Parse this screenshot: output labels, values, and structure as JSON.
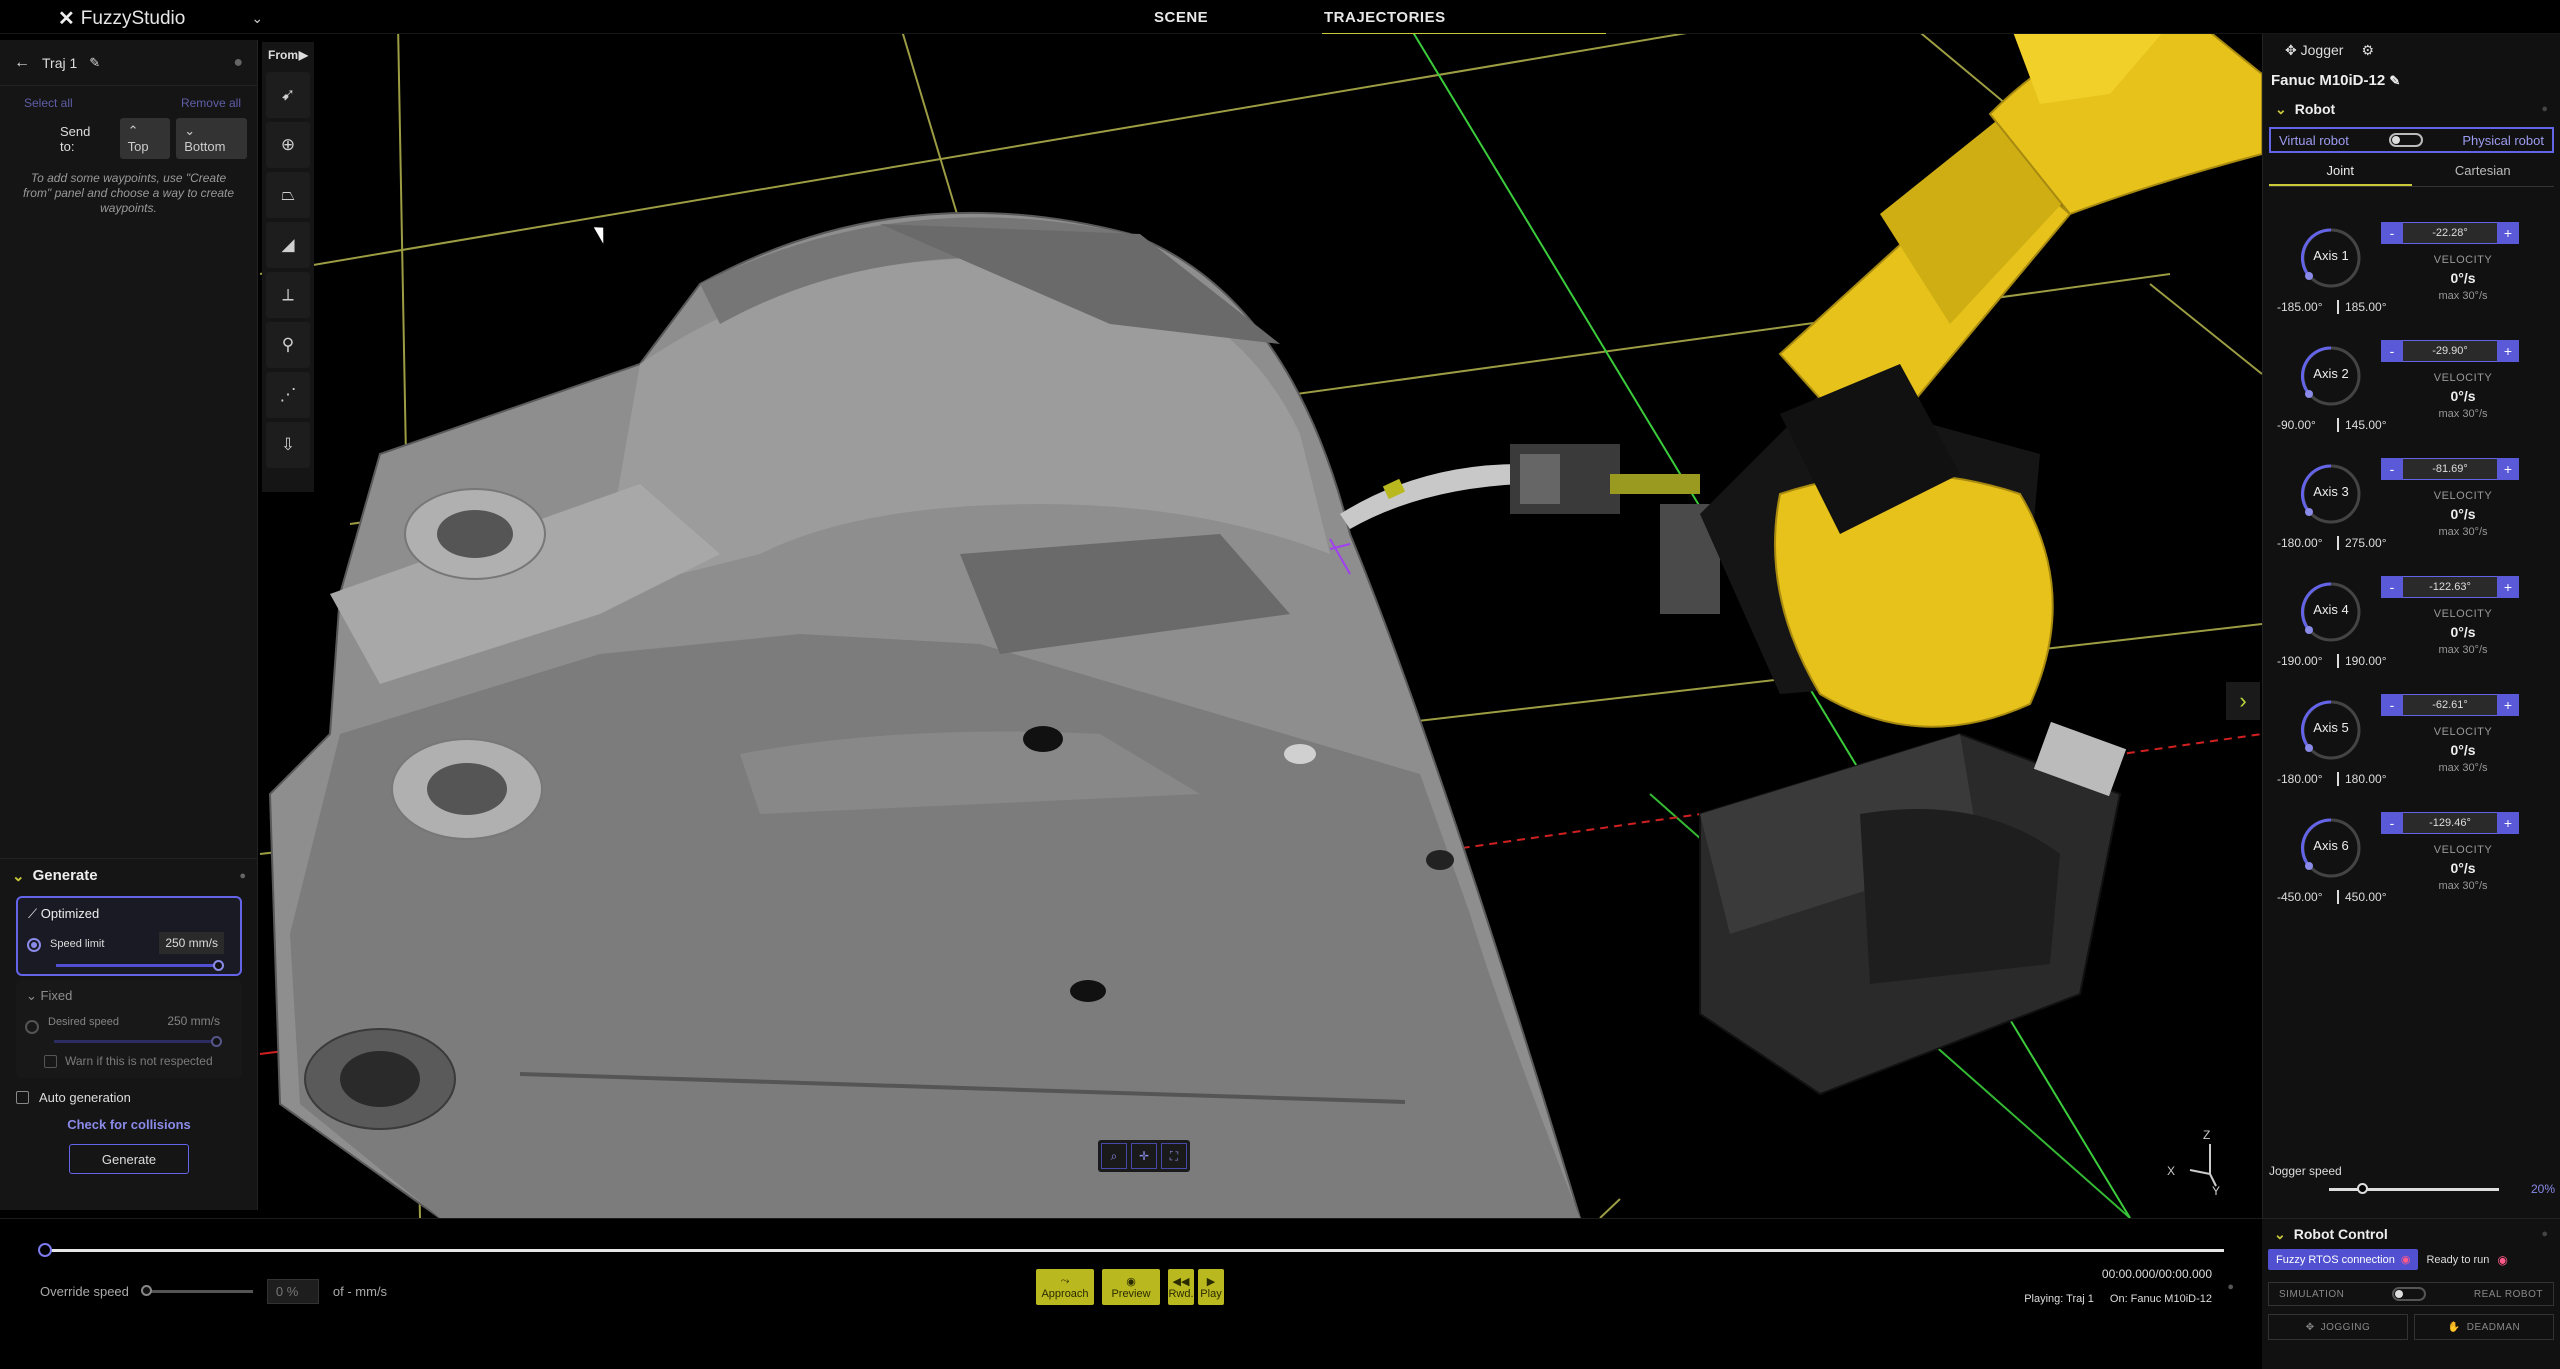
{
  "app": {
    "name": "FuzzyStudio"
  },
  "nav": {
    "tabs": [
      "SCENE",
      "TRAJECTORIES"
    ],
    "active": "TRAJECTORIES"
  },
  "trajectory_panel": {
    "title": "Traj 1",
    "select_all": "Select all",
    "remove_all": "Remove all",
    "send_to": "Send to:",
    "top": "Top",
    "bottom": "Bottom",
    "hint": "To add some waypoints, use \"Create from\" panel and choose a way to create waypoints."
  },
  "generate": {
    "title": "Generate",
    "optimized": {
      "title": "Optimized",
      "label": "Speed limit",
      "value": "250 mm/s",
      "slider_level": 1.0
    },
    "fixed": {
      "title": "Fixed",
      "label": "Desired speed",
      "value": "250 mm/s",
      "warn": "Warn if this is not respected",
      "slider_level": 1.0
    },
    "auto_generation": "Auto generation",
    "check_collisions": "Check for collisions",
    "generate_button": "Generate"
  },
  "from_panel": {
    "label": "From",
    "tools": [
      "cursor-icon",
      "target-icon",
      "surface-icon",
      "solid-icon",
      "frame-icon",
      "pin-icon",
      "path-icon",
      "import-icon"
    ]
  },
  "robot_panel": {
    "jogger": "Jogger",
    "robot_name": "Fanuc M10iD-12",
    "section": "Robot",
    "virtual": "Virtual robot",
    "physical": "Physical robot",
    "tabs": [
      "Joint",
      "Cartesian"
    ],
    "velocity_label": "VELOCITY",
    "axes": [
      {
        "name": "Axis 1",
        "min": "-185.00°",
        "max": "185.00°",
        "value": "-22.28°",
        "velocity": "0°/s",
        "max_vel": "max 30°/s"
      },
      {
        "name": "Axis 2",
        "min": "-90.00°",
        "max": "145.00°",
        "value": "-29.90°",
        "velocity": "0°/s",
        "max_vel": "max 30°/s"
      },
      {
        "name": "Axis 3",
        "min": "-180.00°",
        "max": "275.00°",
        "value": "-81.69°",
        "velocity": "0°/s",
        "max_vel": "max 30°/s"
      },
      {
        "name": "Axis 4",
        "min": "-190.00°",
        "max": "190.00°",
        "value": "-122.63°",
        "velocity": "0°/s",
        "max_vel": "max 30°/s"
      },
      {
        "name": "Axis 5",
        "min": "-180.00°",
        "max": "180.00°",
        "value": "-62.61°",
        "velocity": "0°/s",
        "max_vel": "max 30°/s"
      },
      {
        "name": "Axis 6",
        "min": "-450.00°",
        "max": "450.00°",
        "value": "-129.46°",
        "velocity": "0°/s",
        "max_vel": "max 30°/s"
      }
    ],
    "jogger_speed_label": "Jogger speed",
    "jogger_speed_value": "20%",
    "jogger_speed_level": 0.2
  },
  "robot_control": {
    "title": "Robot Control",
    "connection": "Fuzzy RTOS connection",
    "ready": "Ready to run",
    "simulation": "SIMULATION",
    "real_robot": "REAL ROBOT",
    "jogging": "JOGGING",
    "deadman": "DEADMAN"
  },
  "playback": {
    "override_label": "Override speed",
    "override_value": "0 %",
    "override_unit": "of - mm/s",
    "approach": "Approach",
    "preview": "Preview",
    "rwd": "Rwd.",
    "play": "Play",
    "time": "00:00.000/00:00.000",
    "playing": "Playing: Traj 1",
    "on": "On: Fanuc M10iD-12"
  },
  "axes_gizmo": {
    "x": "X",
    "y": "Y",
    "z": "Z"
  },
  "colors": {
    "accent": "#6464e8",
    "yellow": "#c9c93a",
    "robot_yellow": "#e6c21a",
    "grid_yellow": "#b8b850",
    "axis_green": "#3acc3a",
    "axis_red": "#d02020"
  }
}
